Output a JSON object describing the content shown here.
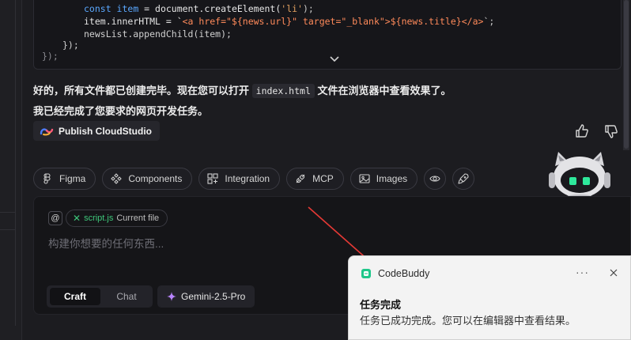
{
  "code": {
    "line1": {
      "kw": "const",
      "name": " item",
      "rest": " = document.createElement(",
      "str": "'li'",
      "end": ");"
    },
    "line2": {
      "prefix": "item.innerHTML = `",
      "tpl": "<a href=\"${news.url}\" target=\"_blank\">${news.title}</a>",
      "end": "`;"
    },
    "line3": "newsList.appendChild(item);",
    "line4": "});",
    "line5": "});"
  },
  "messages": {
    "line1_pre": "好的，所有文件都已创建完毕。现在您可以打开",
    "line1_code": "index.html",
    "line1_post": "文件在浏览器中查看效果了。",
    "line2": "我已经完成了您要求的网页开发任务。"
  },
  "publish": {
    "label": "Publish CloudStudio",
    "icon": "cloudstudio-logo-icon"
  },
  "feedback": {
    "like_icon": "thumbs-up-icon",
    "dislike_icon": "thumbs-down-icon"
  },
  "chips": [
    {
      "label": "Figma",
      "icon": "figma-icon"
    },
    {
      "label": "Components",
      "icon": "components-icon"
    },
    {
      "label": "Integration",
      "icon": "integration-icon"
    },
    {
      "label": "MCP",
      "icon": "mcp-icon"
    },
    {
      "label": "Images",
      "icon": "image-icon"
    }
  ],
  "composer": {
    "at_symbol": "@",
    "file_chip": {
      "name": "script.js",
      "tag": "Current file"
    },
    "placeholder": "构建你想要的任何东西...",
    "modes": {
      "active": "Craft",
      "inactive": "Chat"
    },
    "model": "Gemini-2.5-Pro"
  },
  "toast": {
    "app": "CodeBuddy",
    "more": "···",
    "title": "任务完成",
    "body": "任务已成功完成。您可以在编辑器中查看结果。"
  },
  "colors": {
    "accent_green": "#3ec77a",
    "annotation_red": "#e53935",
    "keyword_blue": "#5aa8ff",
    "string_orange": "#e0a060"
  }
}
